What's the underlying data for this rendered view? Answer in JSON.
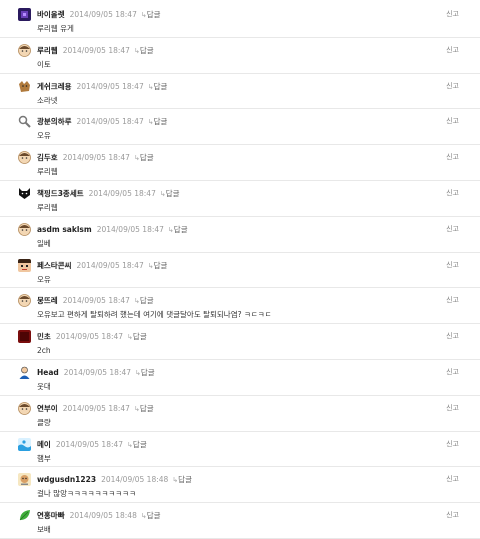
{
  "reply_label": "답글",
  "report_label": "신고",
  "comments": [
    {
      "nick": "바이올렛",
      "date": "2014/09/05 18:47",
      "text": "루리웹 유게",
      "avatar": "purple-square-avatar-icon"
    },
    {
      "nick": "루리웹",
      "date": "2014/09/05 18:47",
      "text": "이토",
      "avatar": "default-face-avatar-icon"
    },
    {
      "nick": "게쉬크레용",
      "date": "2014/09/05 18:47",
      "text": "소라넷",
      "avatar": "dog-avatar-icon"
    },
    {
      "nick": "광분의하루",
      "date": "2014/09/05 18:47",
      "text": "오유",
      "avatar": "magnifier-avatar-icon"
    },
    {
      "nick": "김두호",
      "date": "2014/09/05 18:47",
      "text": "루리웹",
      "avatar": "default-face-avatar-icon"
    },
    {
      "nick": "책핑드3종세트",
      "date": "2014/09/05 18:47",
      "text": "루리웹",
      "avatar": "black-cat-avatar-icon"
    },
    {
      "nick": "asdm saklsm",
      "date": "2014/09/05 18:47",
      "text": "일베",
      "avatar": "default-face-avatar-icon"
    },
    {
      "nick": "페스타콘씨",
      "date": "2014/09/05 18:47",
      "text": "오유",
      "avatar": "pixel-face-avatar-icon"
    },
    {
      "nick": "뭉뜨레",
      "date": "2014/09/05 18:47",
      "text": "오유보고 편하게 탈퇴하려 했는데 여기에 댓글달아도 탈퇴되나염? ㅋㄷㅋㄷ",
      "avatar": "default-face-avatar-icon"
    },
    {
      "nick": "민초",
      "date": "2014/09/05 18:47",
      "text": "2ch",
      "avatar": "dark-red-avatar-icon"
    },
    {
      "nick": "Head",
      "date": "2014/09/05 18:47",
      "text": "웃대",
      "avatar": "person-avatar-icon"
    },
    {
      "nick": "연부이",
      "date": "2014/09/05 18:47",
      "text": "클량",
      "avatar": "default-face-avatar-icon"
    },
    {
      "nick": "메이",
      "date": "2014/09/05 18:47",
      "text": "햄부",
      "avatar": "wave-avatar-icon"
    },
    {
      "nick": "wdgusdn1223",
      "date": "2014/09/05 18:48",
      "text": "걸나 많앙ㅋㅋㅋㅋㅋㅋㅋㅋㅋㅋ",
      "avatar": "sticker-avatar-icon"
    },
    {
      "nick": "연홍마빠",
      "date": "2014/09/05 18:48",
      "text": "보배",
      "avatar": "leaf-avatar-icon"
    }
  ]
}
